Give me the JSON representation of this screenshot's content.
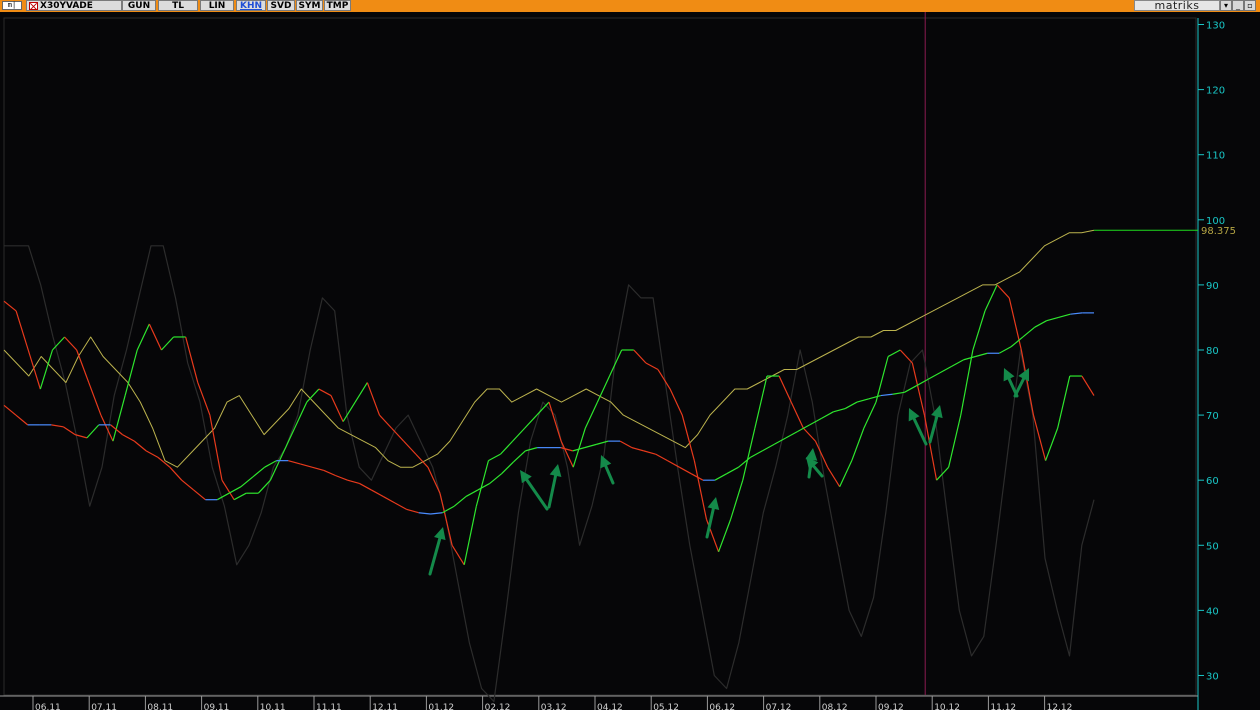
{
  "toolbar": {
    "menu_icon": "m|",
    "symbol": "X30YVADE",
    "buttons": [
      "GUN",
      "TL",
      "LIN",
      "KHN",
      "SVD",
      "SYM",
      "TMP"
    ],
    "active_button": "KHN",
    "brand": "matriks",
    "window_controls": [
      "▾",
      "_",
      "▫",
      "x"
    ]
  },
  "chart_data": {
    "type": "line",
    "last_value_label": "98.375",
    "x_ticks": [
      "06.11",
      "07.11",
      "08.11",
      "09.11",
      "10.11",
      "11.11",
      "12.11",
      "01.12",
      "02.12",
      "03.12",
      "04.12",
      "05.12",
      "06.12",
      "07.12",
      "08.12",
      "09.12",
      "10.12",
      "11.12",
      "12.12"
    ],
    "y_ticks": [
      30,
      40,
      50,
      60,
      70,
      80,
      90,
      100,
      110,
      120,
      130
    ],
    "ylim": [
      27,
      131
    ],
    "colors": {
      "price": "#bcb34e",
      "fast": "#1edc1e",
      "slow_up": "#2ee62e",
      "slow_down": "#e83a1c",
      "flat": "#4a8cff",
      "oscillator": "#2c2c2c",
      "arrow": "#148a4a",
      "cursor": "#8a1a50",
      "axis": "#19c7c7"
    },
    "cursor_x": "10.12",
    "series": [
      {
        "key": "price",
        "values": [
          80,
          78,
          76,
          79,
          77,
          75,
          79,
          82,
          79,
          77,
          75,
          72,
          68,
          63,
          62,
          64,
          66,
          68,
          72,
          73,
          70,
          67,
          69,
          71,
          74,
          72,
          70,
          68,
          67,
          66,
          65,
          63,
          62,
          62,
          63,
          64,
          66,
          69,
          72,
          74,
          74,
          72,
          73,
          74,
          73,
          72,
          73,
          74,
          73,
          72,
          70,
          69,
          68,
          67,
          66,
          65,
          67,
          70,
          72,
          74,
          74,
          75,
          76,
          77,
          77,
          78,
          79,
          80,
          81,
          82,
          82,
          83,
          83,
          84,
          85,
          86,
          87,
          88,
          89,
          90,
          90,
          91,
          92,
          94,
          96,
          97,
          98,
          98,
          98.4
        ]
      },
      {
        "key": "oscillator",
        "values": [
          96,
          96,
          96,
          90,
          82,
          75,
          66,
          56,
          62,
          73,
          80,
          88,
          96,
          96,
          88,
          78,
          72,
          62,
          56,
          47,
          50,
          55,
          62,
          65,
          70,
          80,
          88,
          86,
          70,
          62,
          60,
          64,
          68,
          70,
          66,
          62,
          55,
          45,
          35,
          28,
          26,
          40,
          55,
          66,
          72,
          70,
          62,
          50,
          56,
          64,
          80,
          90,
          88,
          88,
          75,
          62,
          50,
          40,
          30,
          28,
          35,
          45,
          55,
          62,
          70,
          80,
          72,
          60,
          50,
          40,
          36,
          42,
          55,
          70,
          78,
          80,
          70,
          55,
          40,
          33,
          36,
          50,
          65,
          80,
          70,
          48,
          40,
          33,
          50,
          57
        ]
      },
      {
        "key": "upper",
        "values": [
          87.5,
          86,
          80,
          74,
          80,
          82,
          80,
          75,
          70,
          66,
          73,
          80,
          84,
          80,
          82,
          82,
          75,
          70,
          60,
          57,
          58,
          58,
          60,
          64,
          68,
          72,
          74,
          73,
          69,
          72,
          75,
          70,
          68,
          66,
          64,
          62,
          58,
          50,
          47,
          56,
          63,
          64,
          66,
          68,
          70,
          72,
          66,
          62,
          68,
          72,
          76,
          80,
          80,
          78,
          77,
          74,
          70,
          63,
          54,
          49,
          54,
          60,
          68,
          76,
          76,
          72,
          68,
          66,
          62,
          59,
          63,
          68,
          72,
          79,
          80,
          78,
          70,
          60,
          62,
          70,
          80,
          86,
          90,
          88,
          80,
          70,
          63,
          68,
          76,
          76,
          73
        ]
      },
      {
        "key": "middle",
        "values": [
          71.5,
          70,
          68.5,
          68.5,
          68.5,
          68.2,
          67,
          66.5,
          68.5,
          68.5,
          67,
          66,
          64.5,
          63.5,
          62,
          60,
          58.5,
          57,
          57,
          58,
          59,
          60.5,
          62,
          63,
          63,
          62.5,
          62,
          61.5,
          60.7,
          60,
          59.5,
          58.5,
          57.5,
          56.5,
          55.5,
          55,
          54.8,
          55,
          56,
          57.5,
          58.5,
          59.5,
          61,
          62.8,
          64.5,
          65,
          65,
          65,
          64.5,
          65,
          65.5,
          66,
          66,
          65,
          64.5,
          64,
          63,
          62,
          61,
          60,
          60,
          61,
          62,
          63.5,
          64.5,
          65.5,
          66.5,
          67.5,
          68.5,
          69.5,
          70.5,
          71,
          72,
          72.5,
          73,
          73.2,
          73.5,
          74.5,
          75.5,
          76.5,
          77.5,
          78.5,
          79,
          79.5,
          79.5,
          80.5,
          82,
          83.5,
          84.5,
          85,
          85.5,
          85.7,
          85.7
        ]
      }
    ]
  }
}
